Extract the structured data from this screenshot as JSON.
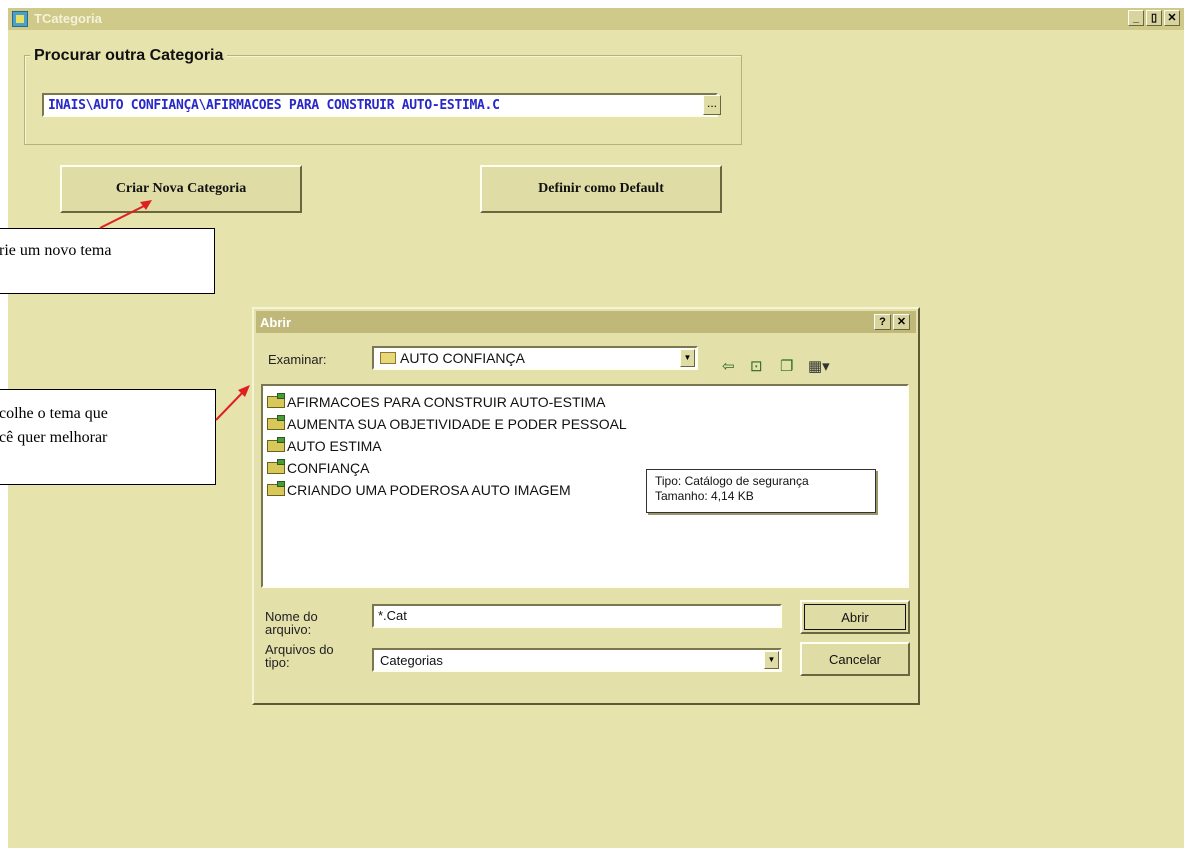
{
  "window": {
    "title": "TCategoria",
    "minimize_label": "_",
    "maximize_label": "▯",
    "close_label": "✕"
  },
  "search_group": {
    "legend": "Procurar outra Categoria",
    "path_value": "INAIS\\AUTO CONFIANÇA\\AFIRMACOES PARA CONSTRUIR AUTO-ESTIMA.C",
    "browse_label": "..."
  },
  "buttons": {
    "create": "Criar Nova Categoria",
    "default": "Definir como Default"
  },
  "callouts": {
    "create": "rie um novo tema",
    "choose_line1": "colhe o tema que",
    "choose_line2": "cê quer melhorar"
  },
  "dialog": {
    "title": "Abrir",
    "help_label": "?",
    "close_label": "✕",
    "look_in_label": "Examinar:",
    "look_in_value": "AUTO CONFIANÇA",
    "toolbar_icons": [
      "back-icon",
      "up-folder-icon",
      "new-folder-icon",
      "view-menu-icon"
    ],
    "files": [
      "AFIRMACOES PARA CONSTRUIR AUTO-ESTIMA",
      "AUMENTA SUA OBJETIVIDADE E PODER PESSOAL",
      "AUTO ESTIMA",
      "CONFIANÇA",
      "CRIANDO UMA PODEROSA AUTO IMAGEM"
    ],
    "tooltip_line1": "Tipo: Catálogo de segurança",
    "tooltip_line2": "Tamanho: 4,14 KB",
    "filename_label_line1": "Nome do",
    "filename_label_line2": "arquivo:",
    "filename_value": "*.Cat",
    "filetype_label_line1": "Arquivos do",
    "filetype_label_line2": "tipo:",
    "filetype_value": "Categorias",
    "open_button": "Abrir",
    "cancel_button": "Cancelar"
  },
  "colors": {
    "background": "#e6e3ad",
    "path_text": "#2828c8",
    "arrow": "#e02020"
  }
}
